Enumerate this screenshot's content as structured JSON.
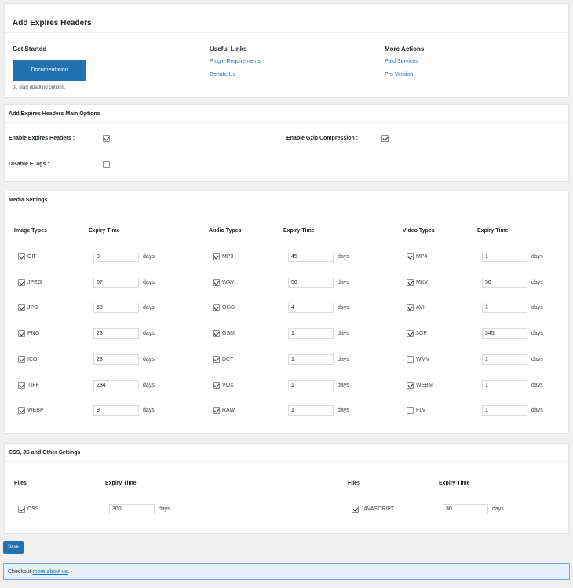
{
  "header": {
    "title": "Add Expires Headers",
    "get_started": {
      "heading": "Get Started",
      "button_label": "Documentation",
      "note": "or, start upadting options."
    },
    "useful_links": {
      "heading": "Useful Links",
      "links": [
        "Plugin Requirements",
        "Donate Us"
      ]
    },
    "more_actions": {
      "heading": "More Actions",
      "links": [
        "Paid Services",
        "Pro Version"
      ]
    }
  },
  "main_options": {
    "title": "Add Expires Headers Main Options",
    "enable_expires": {
      "label": "Enable Expires Headers :",
      "checked": true
    },
    "enable_gzip": {
      "label": "Enable Gzip Compression :",
      "checked": true
    },
    "disable_etags": {
      "label": "Disable ETags :",
      "checked": false
    }
  },
  "media": {
    "title": "Media Settings",
    "expiry_header": "Expiry Time",
    "unit": "days",
    "groups": [
      {
        "heading": "Image Types",
        "rows": [
          {
            "type": "GIF",
            "checked": true,
            "value": "0"
          },
          {
            "type": "JPEG",
            "checked": true,
            "value": "67"
          },
          {
            "type": "JPG",
            "checked": true,
            "value": "60"
          },
          {
            "type": "PNG",
            "checked": true,
            "value": "23"
          },
          {
            "type": "ICO",
            "checked": true,
            "value": "23"
          },
          {
            "type": "TIFF",
            "checked": true,
            "value": "234"
          },
          {
            "type": "WEBP",
            "checked": true,
            "value": "9"
          }
        ]
      },
      {
        "heading": "Audio Types",
        "rows": [
          {
            "type": "MP3",
            "checked": true,
            "value": "45"
          },
          {
            "type": "WAV",
            "checked": true,
            "value": "56"
          },
          {
            "type": "OGG",
            "checked": true,
            "value": "4"
          },
          {
            "type": "GSM",
            "checked": true,
            "value": "1"
          },
          {
            "type": "DCT",
            "checked": true,
            "value": "1"
          },
          {
            "type": "VOX",
            "checked": true,
            "value": "1"
          },
          {
            "type": "RAW",
            "checked": true,
            "value": "1"
          }
        ]
      },
      {
        "heading": "Video Types",
        "rows": [
          {
            "type": "MP4",
            "checked": true,
            "value": "1"
          },
          {
            "type": "MKV",
            "checked": true,
            "value": "56"
          },
          {
            "type": "AVI",
            "checked": true,
            "value": "1"
          },
          {
            "type": "3GP",
            "checked": true,
            "value": "345"
          },
          {
            "type": "WMV",
            "checked": false,
            "value": "1"
          },
          {
            "type": "WEBM",
            "checked": true,
            "value": "1"
          },
          {
            "type": "FLV",
            "checked": false,
            "value": "1"
          }
        ]
      }
    ]
  },
  "other": {
    "title": "CSS, JS and Other Settings",
    "files_header": "Files",
    "expiry_header": "Expiry Time",
    "unit": "days",
    "rows": [
      {
        "type": "CSS",
        "checked": true,
        "value": "300"
      },
      {
        "type": "JAVASCRIPT",
        "checked": true,
        "value": "30"
      }
    ]
  },
  "save_label": "Save",
  "notice": {
    "text": "Checkout ",
    "link": "more about us",
    "suffix": "."
  },
  "colors": {
    "accent": "#2271b1",
    "notice_bg": "#e5f0fb",
    "notice_border": "#72aee6"
  }
}
